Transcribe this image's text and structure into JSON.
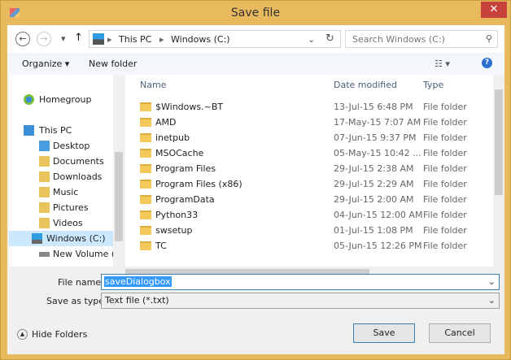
{
  "window": {
    "title": "Save file",
    "close": "✕"
  },
  "address": {
    "back": "←",
    "forward": "→",
    "recent": "▾",
    "up": "↑",
    "crumbs": [
      "This PC",
      "Windows (C:)"
    ],
    "sep": "▸",
    "dropdown": "⌄",
    "refresh": "↻",
    "search_placeholder": "Search Windows (C:)",
    "search_icon": "⚲"
  },
  "toolbar": {
    "organize": "Organize ▾",
    "new_folder": "New folder",
    "view": "☷ ▾",
    "help": "?"
  },
  "nav": {
    "items": [
      {
        "label": "Homegroup"
      },
      {
        "label": "This PC"
      },
      {
        "label": "Desktop"
      },
      {
        "label": "Documents"
      },
      {
        "label": "Downloads"
      },
      {
        "label": "Music"
      },
      {
        "label": "Pictures"
      },
      {
        "label": "Videos"
      },
      {
        "label": "Windows (C:)"
      },
      {
        "label": "New Volume (D:)"
      }
    ]
  },
  "list": {
    "columns": [
      "Name",
      "Date modified",
      "Type"
    ],
    "rows": [
      {
        "name": "$Windows.~BT",
        "date": "13-Jul-15 6:48 PM",
        "type": "File folder"
      },
      {
        "name": "AMD",
        "date": "17-May-15 7:07 AM",
        "type": "File folder"
      },
      {
        "name": "inetpub",
        "date": "07-Jun-15 9:37 PM",
        "type": "File folder"
      },
      {
        "name": "MSOCache",
        "date": "05-May-15 10:42 ...",
        "type": "File folder"
      },
      {
        "name": "Program Files",
        "date": "29-Jul-15 2:38 AM",
        "type": "File folder"
      },
      {
        "name": "Program Files (x86)",
        "date": "29-Jul-15 2:29 AM",
        "type": "File folder"
      },
      {
        "name": "ProgramData",
        "date": "29-Jul-15 2:00 AM",
        "type": "File folder"
      },
      {
        "name": "Python33",
        "date": "04-Jun-15 12:00 AM",
        "type": "File folder"
      },
      {
        "name": "swsetup",
        "date": "01-Jul-15 1:08 PM",
        "type": "File folder"
      },
      {
        "name": "TC",
        "date": "05-Jun-15 12:26 PM",
        "type": "File folder"
      }
    ]
  },
  "form": {
    "filename_label": "File name:",
    "filename_value": "saveDialogbox",
    "type_label": "Save as type:",
    "type_value": "Text file (*.txt)"
  },
  "footer": {
    "hide_folders": "Hide Folders",
    "save": "Save",
    "cancel": "Cancel"
  }
}
